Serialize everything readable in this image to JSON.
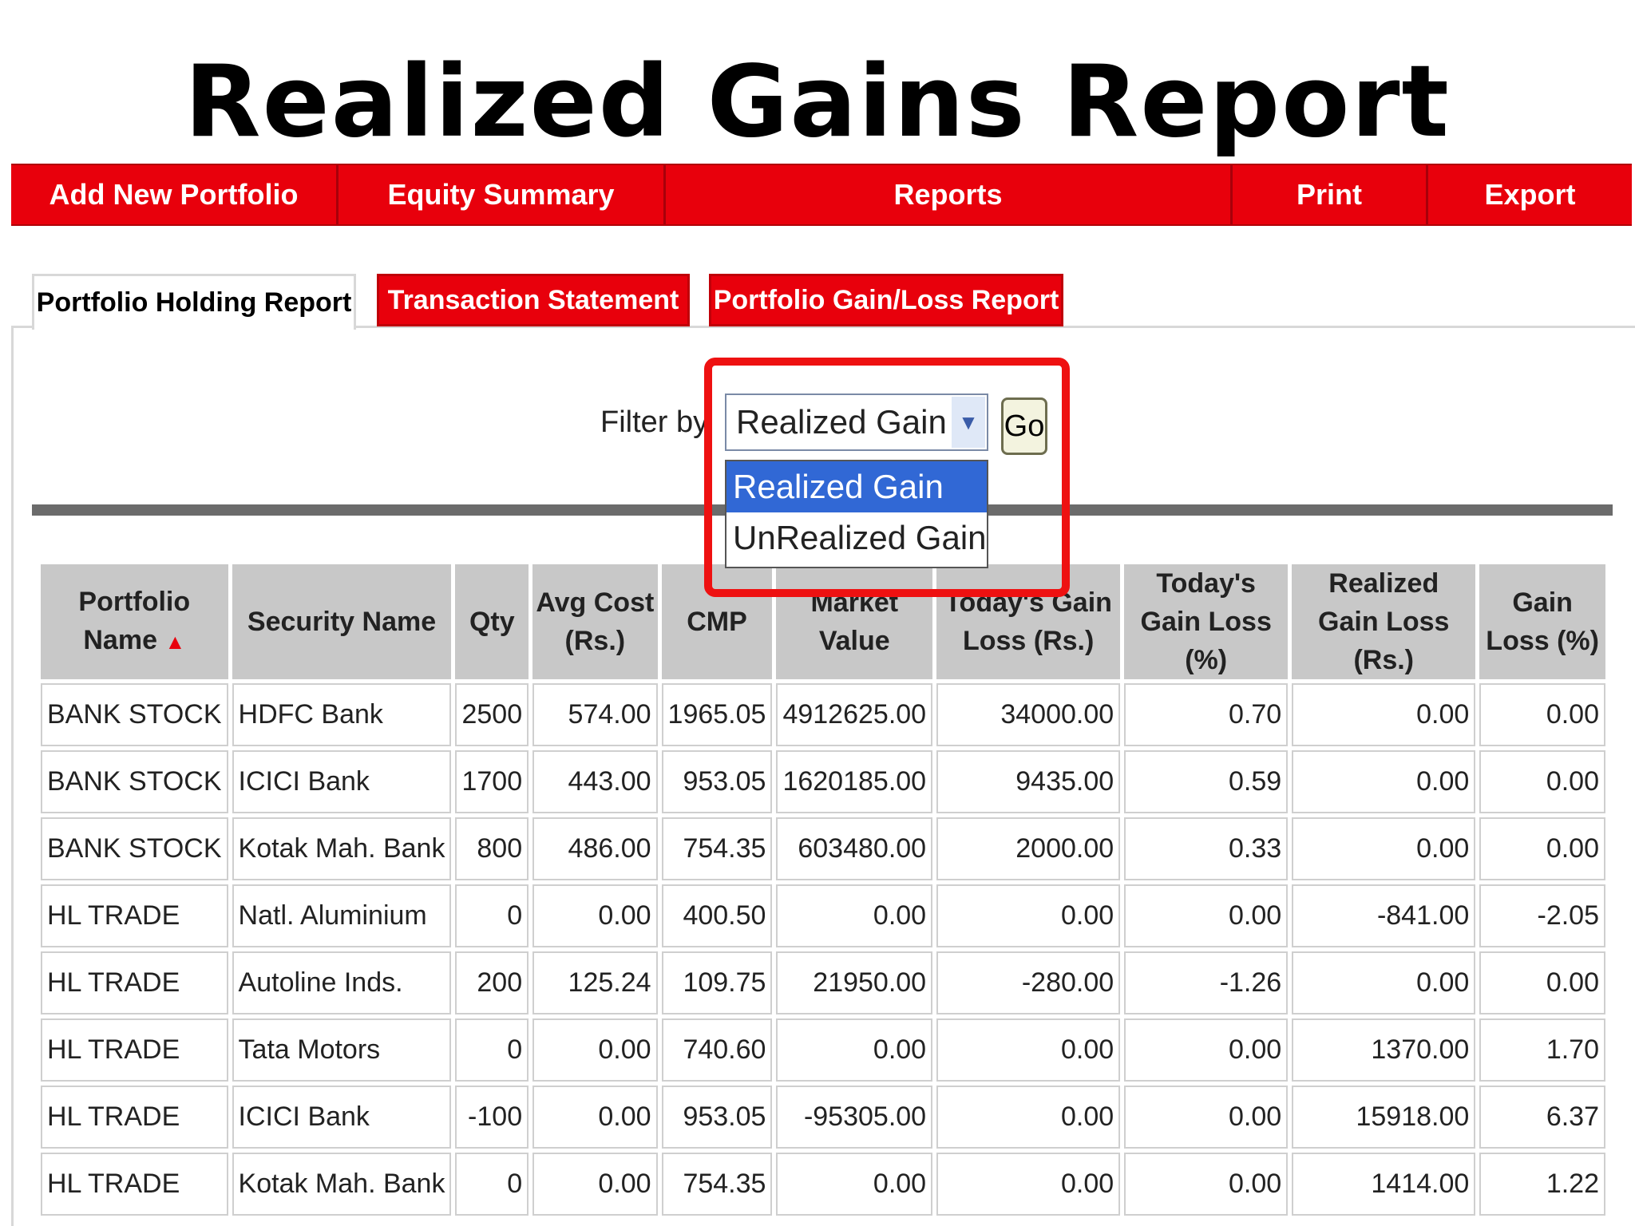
{
  "title": "Realized Gains Report",
  "nav": {
    "items": [
      "Add New Portfolio",
      "Equity Summary",
      "Reports",
      "Print",
      "Export"
    ]
  },
  "tabs": [
    "Portfolio Holding Report",
    "Transaction Statement",
    "Portfolio Gain/Loss Report"
  ],
  "filter": {
    "label": "Filter by",
    "selected": "Realized Gain",
    "options": [
      "Realized Gain",
      "UnRealized Gain"
    ],
    "go_label": "Go"
  },
  "table": {
    "headers": [
      "Portfolio Name",
      "Security Name",
      "Qty",
      "Avg Cost (Rs.)",
      "CMP",
      "Market Value",
      "Today's Gain Loss (Rs.)",
      "Today's Gain Loss (%)",
      "Realized Gain Loss (Rs.)",
      "Gain Loss (%)"
    ],
    "sort_indicator": "▲",
    "rows": [
      [
        "BANK STOCK",
        "HDFC Bank",
        "2500",
        "574.00",
        "1965.05",
        "4912625.00",
        "34000.00",
        "0.70",
        "0.00",
        "0.00"
      ],
      [
        "BANK STOCK",
        "ICICI Bank",
        "1700",
        "443.00",
        "953.05",
        "1620185.00",
        "9435.00",
        "0.59",
        "0.00",
        "0.00"
      ],
      [
        "BANK STOCK",
        "Kotak Mah. Bank",
        "800",
        "486.00",
        "754.35",
        "603480.00",
        "2000.00",
        "0.33",
        "0.00",
        "0.00"
      ],
      [
        "HL TRADE",
        "Natl. Aluminium",
        "0",
        "0.00",
        "400.50",
        "0.00",
        "0.00",
        "0.00",
        "-841.00",
        "-2.05"
      ],
      [
        "HL TRADE",
        "Autoline Inds.",
        "200",
        "125.24",
        "109.75",
        "21950.00",
        "-280.00",
        "-1.26",
        "0.00",
        "0.00"
      ],
      [
        "HL TRADE",
        "Tata Motors",
        "0",
        "0.00",
        "740.60",
        "0.00",
        "0.00",
        "0.00",
        "1370.00",
        "1.70"
      ],
      [
        "HL TRADE",
        "ICICI Bank",
        "-100",
        "0.00",
        "953.05",
        "-95305.00",
        "0.00",
        "0.00",
        "15918.00",
        "6.37"
      ],
      [
        "HL TRADE",
        "Kotak Mah. Bank",
        "0",
        "0.00",
        "754.35",
        "0.00",
        "0.00",
        "0.00",
        "1414.00",
        "1.22"
      ]
    ]
  }
}
